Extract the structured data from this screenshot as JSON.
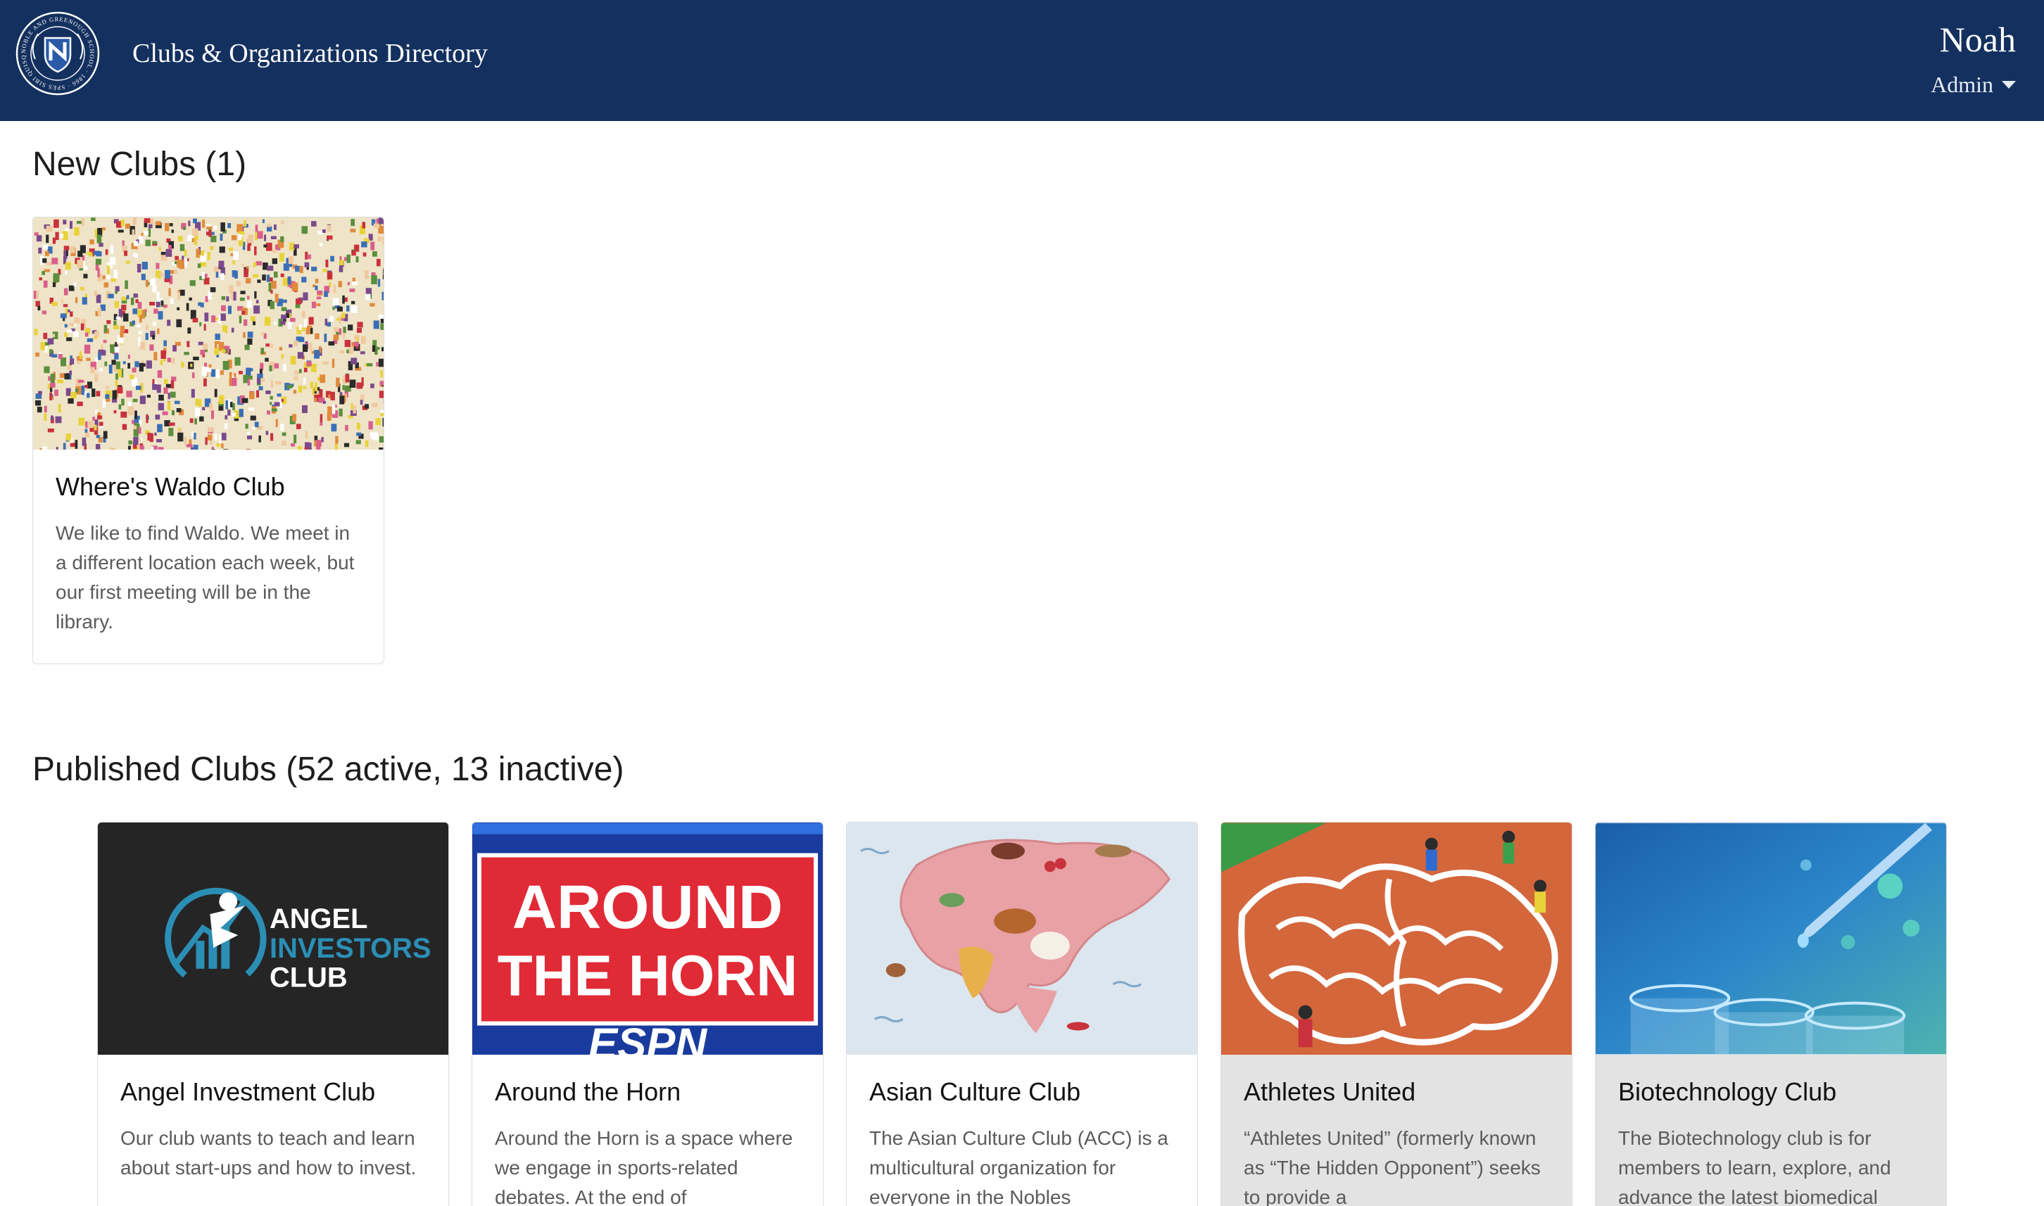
{
  "header": {
    "seal_text": "NOBLE AND GREENOUGH SCHOOL · 1866 · SPES SIBI QUISQUE",
    "title": "Clubs & Organizations Directory",
    "user_name": "Noah",
    "user_role": "Admin",
    "colors": {
      "navbar": "#14305e",
      "text": "#ffffff"
    }
  },
  "new_clubs": {
    "heading": "New Clubs (1)",
    "items": [
      {
        "name": "Where's Waldo Club",
        "description": "We like to find Waldo. We meet in a different location each week, but our first meeting will be in the library.",
        "image_icon": "waldo-crowd-image"
      }
    ]
  },
  "published_clubs": {
    "heading": "Published Clubs (52 active, 13 inactive)",
    "items": [
      {
        "name": "Angel Investment Club",
        "description": "Our club wants to teach and learn about start-ups and how to invest.",
        "image_icon": "angel-investors-logo",
        "logo_text": [
          "ANGEL",
          "INVESTORS",
          "CLUB"
        ]
      },
      {
        "name": "Around the Horn",
        "description": "Around the Horn is a space where we engage in sports-related debates. At the end of",
        "image_icon": "around-the-horn-logo",
        "logo_text": [
          "AROUND",
          "THE HORN",
          "ESPN"
        ]
      },
      {
        "name": "Asian Culture Club",
        "description": "The Asian Culture Club (ACC) is a multicultural organization for everyone in the Nobles",
        "image_icon": "asia-food-map-image"
      },
      {
        "name": "Athletes United",
        "description": "“Athletes United” (formerly known as “The Hidden Opponent”) seeks to provide a",
        "image_icon": "track-brain-image",
        "inactive": true
      },
      {
        "name": "Biotechnology Club",
        "description": "The Biotechnology club is for members to learn, explore, and advance the latest biomedical",
        "image_icon": "pipette-test-tubes-image",
        "inactive": true
      }
    ]
  }
}
